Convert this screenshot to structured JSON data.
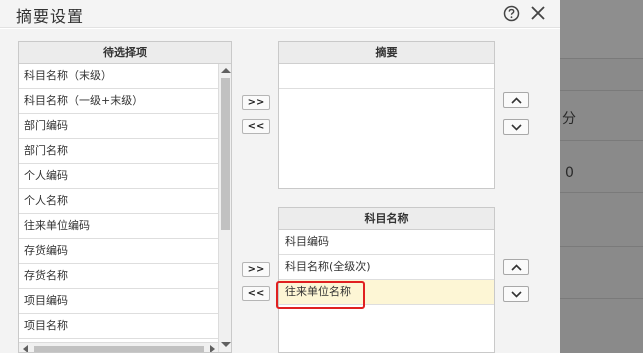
{
  "background": {
    "text_fen": "分",
    "text_zero": "0"
  },
  "dialog": {
    "title": "摘要设置",
    "help_icon": "question-circle-icon",
    "close_icon": "close-x-icon"
  },
  "left_panel": {
    "header": "待选择项",
    "items": [
      "科目名称（末级）",
      "科目名称（一级+末级）",
      "部门编码",
      "部门名称",
      "个人编码",
      "个人名称",
      "往来单位编码",
      "存货编码",
      "存货名称",
      "项目编码",
      "项目名称"
    ]
  },
  "transfer_top": {
    "add": ">>",
    "remove": "<<"
  },
  "transfer_bottom": {
    "add": ">>",
    "remove": "<<"
  },
  "summary_panel": {
    "header": "摘要",
    "items": []
  },
  "account_panel": {
    "header": "科目名称",
    "items": [
      "科目编码",
      "科目名称(全级次)",
      "往来单位名称"
    ],
    "selected_index": 2
  },
  "colors": {
    "selected_row": "#fdf6d5",
    "highlight_border": "#e02020"
  }
}
